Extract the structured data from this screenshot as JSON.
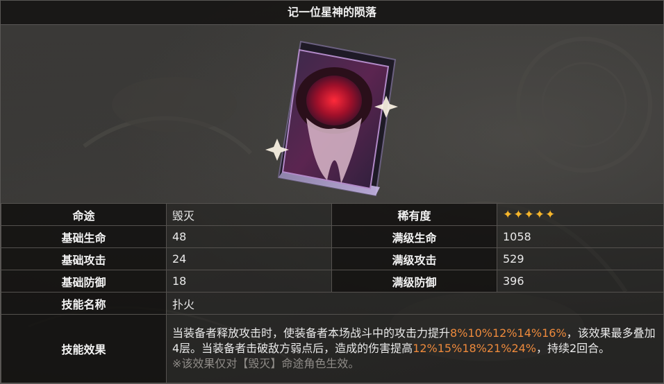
{
  "title": "记一位星神的陨落",
  "stats": {
    "path_label": "命途",
    "path_value": "毁灭",
    "rarity_label": "稀有度",
    "rarity_stars": "✦✦✦✦✦",
    "rarity_value": 5,
    "base_hp_label": "基础生命",
    "base_hp": "48",
    "max_hp_label": "满级生命",
    "max_hp": "1058",
    "base_atk_label": "基础攻击",
    "base_atk": "24",
    "max_atk_label": "满级攻击",
    "max_atk": "529",
    "base_def_label": "基础防御",
    "base_def": "18",
    "max_def_label": "满级防御",
    "max_def": "396",
    "skill_name_label": "技能名称",
    "skill_name": "扑火",
    "skill_effect_label": "技能效果",
    "skill_effect": {
      "part1": "当装备者释放攻击时，使装备者本场战斗中的攻击力提升",
      "hl1": "8%10%12%14%16%",
      "part2": "，该效果最多叠加4层。当装备者击破敌方弱点后，造成的伤害提高",
      "hl2": "12%15%18%21%24%",
      "part3": "，持续2回合。",
      "note": "※该效果仅对【毁灭】命途角色生效。"
    }
  },
  "colors": {
    "highlight": "#ee8a3c",
    "star": "#f7b62b",
    "note": "#8f8c88"
  },
  "icons": {
    "rarity": "star-icon",
    "artwork": "light-cone-book-icon"
  }
}
